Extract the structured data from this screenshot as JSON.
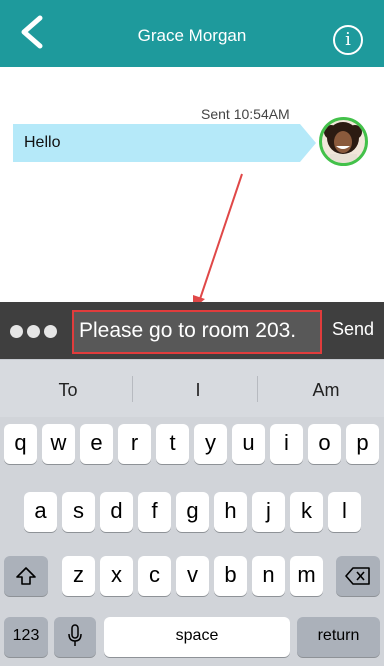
{
  "header": {
    "title": "Grace Morgan",
    "back_icon": "chevron-left-icon",
    "info_icon": "info-icon",
    "info_glyph": "i",
    "bg_color": "#1e9a9c"
  },
  "conversation": {
    "messages": [
      {
        "sender": "self",
        "meta": "Sent 10:54AM",
        "text": "Hello",
        "avatar": "user-avatar"
      }
    ]
  },
  "compose": {
    "more_icon": "ellipsis-icon",
    "input_value": "Please go to room 203.",
    "send_label": "Send",
    "highlight_color": "#e03c3c"
  },
  "keyboard": {
    "suggestions": [
      "To",
      "I",
      "Am"
    ],
    "row1": [
      "q",
      "w",
      "e",
      "r",
      "t",
      "y",
      "u",
      "i",
      "o",
      "p"
    ],
    "row2": [
      "a",
      "s",
      "d",
      "f",
      "g",
      "h",
      "j",
      "k",
      "l"
    ],
    "row3": [
      "z",
      "x",
      "c",
      "v",
      "b",
      "n",
      "m"
    ],
    "shift_icon": "shift-icon",
    "delete_icon": "backspace-icon",
    "numbers_label": "123",
    "mic_icon": "microphone-icon",
    "space_label": "space",
    "return_label": "return"
  }
}
